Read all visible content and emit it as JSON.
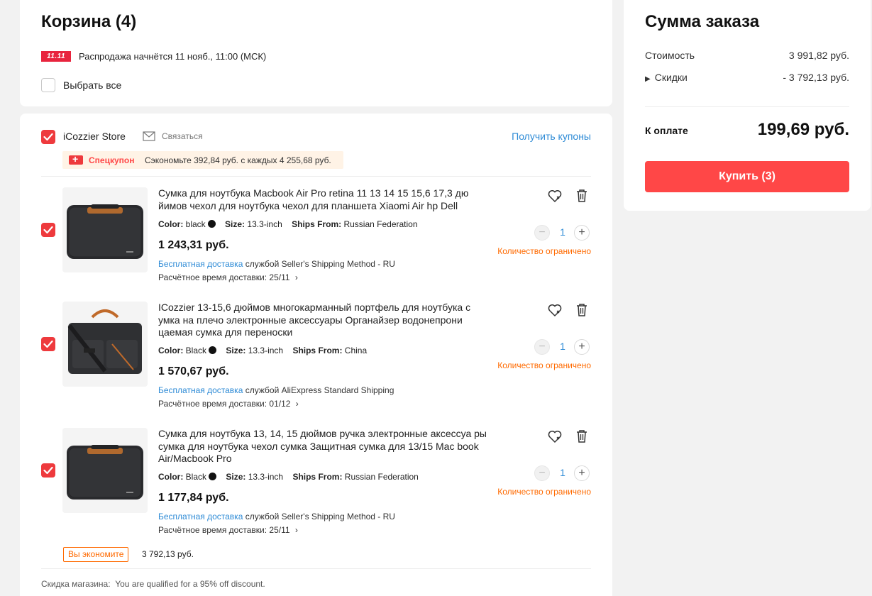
{
  "cart": {
    "title": "Корзина (4)",
    "sale_badge": "11.11",
    "sale_text": "Распродажа начнётся 11 нояб., 11:00 (МСК)",
    "select_all": "Выбрать все"
  },
  "store": {
    "name": "iCozzier Store",
    "contact": "Связаться",
    "get_coupons": "Получить купоны",
    "coupon_label": "Спецкупон",
    "coupon_text": "Сэкономьте 392,84 руб. с каждых 4 255,68 руб.",
    "save_badge": "Вы экономите",
    "save_amount": "3 792,13 руб.",
    "discount_label": "Скидка магазина:",
    "discount_text": "You are qualified for a 95% off discount."
  },
  "labels": {
    "color": "Color:",
    "size": "Size:",
    "ships_from": "Ships From:",
    "free_shipping": "Бесплатная доставка",
    "eta_label": "Расчётное время доставки:",
    "limited": "Количество ограничено"
  },
  "products": [
    {
      "title": "Сумка для ноутбука Macbook Air Pro retina 11 13 14 15 15,6 17,3 дю йимов чехол для ноутбука чехол для планшета Xiaomi Air hp Dell",
      "color": "black",
      "size": "13.3-inch",
      "ships_from": "Russian Federation",
      "price": "1 243,31 руб.",
      "shipping_method": "службой Seller's Shipping Method - RU",
      "eta": "25/11",
      "qty": "1"
    },
    {
      "title": "ICozzier 13-15,6 дюймов многокарманный портфель для ноутбука с умка на плечо электронные аксессуары Органайзер водонепрони цаемая сумка для переноски",
      "color": "Black",
      "size": "13.3-inch",
      "ships_from": "China",
      "price": "1 570,67 руб.",
      "shipping_method": "службой AliExpress Standard Shipping",
      "eta": "01/12",
      "qty": "1"
    },
    {
      "title": "Сумка для ноутбука 13, 14, 15 дюймов ручка электронные аксессуа ры сумка для ноутбука чехол сумка Защитная сумка для 13/15 Mac book Air/Macbook Pro",
      "color": "Black",
      "size": "13.3-inch",
      "ships_from": "Russian Federation",
      "price": "1 177,84 руб.",
      "shipping_method": "службой Seller's Shipping Method - RU",
      "eta": "25/11",
      "qty": "1"
    }
  ],
  "summary": {
    "title": "Сумма заказа",
    "cost_label": "Стоимость",
    "cost_value": "3 991,82 руб.",
    "discount_label": "Скидки",
    "discount_value": "- 3 792,13 руб.",
    "total_label": "К оплате",
    "total_value": "199,69 руб.",
    "buy_button": "Купить (3)"
  },
  "colors": {
    "accent": "#ee3a3d",
    "link": "#2e8bd6",
    "warning": "#ff6a00",
    "buy": "#ff4747"
  }
}
